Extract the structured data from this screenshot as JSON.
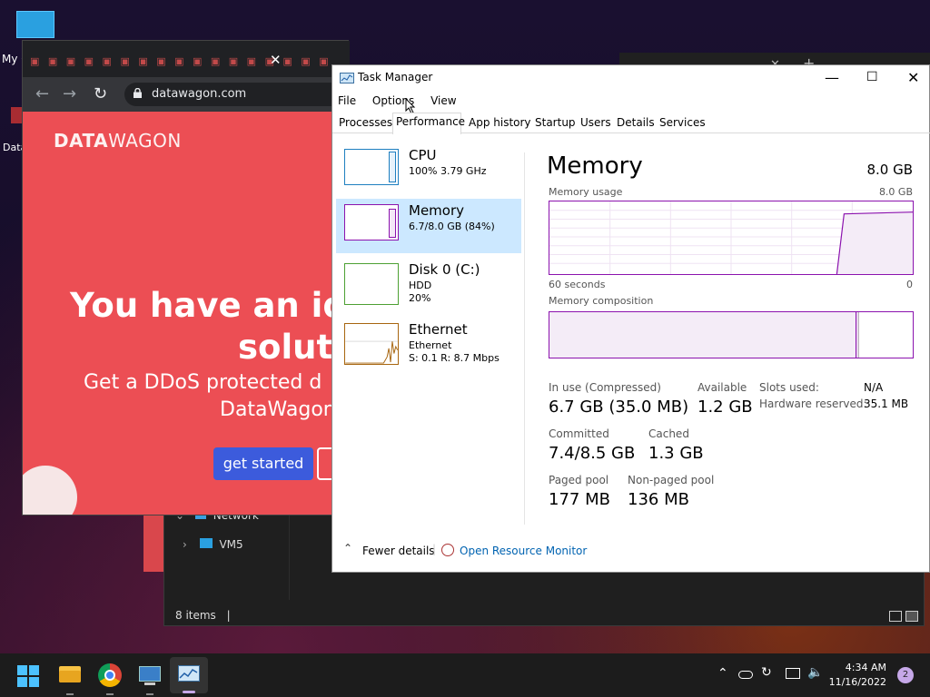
{
  "desktop": {
    "icon1_label": "My C",
    "icon2_label": "Data"
  },
  "explorer": {
    "tree_items": [
      "Network",
      "VM5"
    ],
    "status": "8 items"
  },
  "browser": {
    "url": "datawagon.com",
    "site": {
      "logo_bold": "DATA",
      "logo_rest": "WAGON",
      "hero_line1": "You have an ide",
      "hero_line2": "soluti",
      "sub_line1": "Get a DDoS protected d",
      "sub_line2": "DataWagon",
      "cta": "get started"
    }
  },
  "task_manager": {
    "title": "Task Manager",
    "menu": [
      "File",
      "Options",
      "View"
    ],
    "tabs": [
      "Processes",
      "Performance",
      "App history",
      "Startup",
      "Users",
      "Details",
      "Services"
    ],
    "active_tab": "Performance",
    "resources": [
      {
        "name": "CPU",
        "line1": "100%  3.79 GHz",
        "line2": ""
      },
      {
        "name": "Memory",
        "line1": "6.7/8.0 GB (84%)",
        "line2": ""
      },
      {
        "name": "Disk 0 (C:)",
        "line1": "HDD",
        "line2": "20%"
      },
      {
        "name": "Ethernet",
        "line1": "Ethernet",
        "line2": "S: 0.1  R: 8.7 Mbps"
      }
    ],
    "memory": {
      "title": "Memory",
      "total": "8.0 GB",
      "usage_label": "Memory usage",
      "usage_max": "8.0 GB",
      "time_left": "60 seconds",
      "time_right": "0",
      "composition_label": "Memory composition",
      "in_use_label": "In use (Compressed)",
      "in_use_value": "6.7 GB (35.0 MB)",
      "available_label": "Available",
      "available_value": "1.2 GB",
      "slots_label": "Slots used:",
      "slots_value": "N/A",
      "hw_reserved_label": "Hardware reserved:",
      "hw_reserved_value": "35.1 MB",
      "committed_label": "Committed",
      "committed_value": "7.4/8.5 GB",
      "cached_label": "Cached",
      "cached_value": "1.3 GB",
      "paged_label": "Paged pool",
      "paged_value": "177 MB",
      "nonpaged_label": "Non-paged pool",
      "nonpaged_value": "136 MB"
    },
    "footer": {
      "fewer": "Fewer details",
      "open_monitor": "Open Resource Monitor"
    },
    "accent_color": "#8b12ae"
  },
  "taskbar": {
    "time": "4:34 AM",
    "date": "11/16/2022",
    "notifications": "2"
  }
}
